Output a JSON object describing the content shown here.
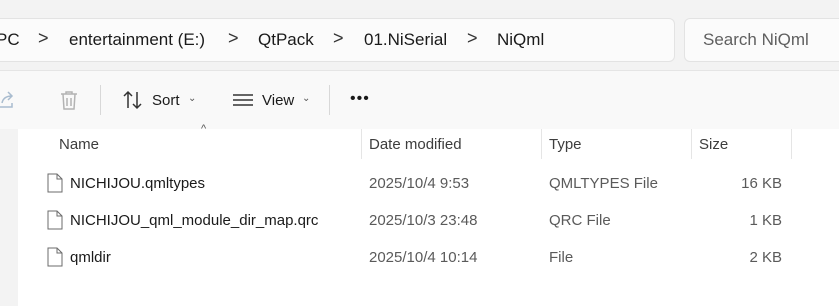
{
  "breadcrumb": {
    "items": [
      "PC",
      "entertainment (E:)",
      "QtPack",
      "01.NiSerial",
      "NiQml"
    ],
    "separator": ">"
  },
  "search": {
    "placeholder": "Search NiQml"
  },
  "toolbar": {
    "share_icon": "share-icon",
    "delete_icon": "trash-icon",
    "sort_label": "Sort",
    "view_label": "View",
    "more_label": "•••"
  },
  "columns": {
    "name": "Name",
    "date": "Date modified",
    "type": "Type",
    "size": "Size"
  },
  "files": [
    {
      "name": "NICHIJOU.qmltypes",
      "date": "2025/10/4 9:53",
      "type": "QMLTYPES File",
      "size": "16 KB"
    },
    {
      "name": "NICHIJOU_qml_module_dir_map.qrc",
      "date": "2025/10/3 23:48",
      "type": "QRC File",
      "size": "1 KB"
    },
    {
      "name": "qmldir",
      "date": "2025/10/4 10:14",
      "type": "File",
      "size": "2 KB"
    }
  ]
}
